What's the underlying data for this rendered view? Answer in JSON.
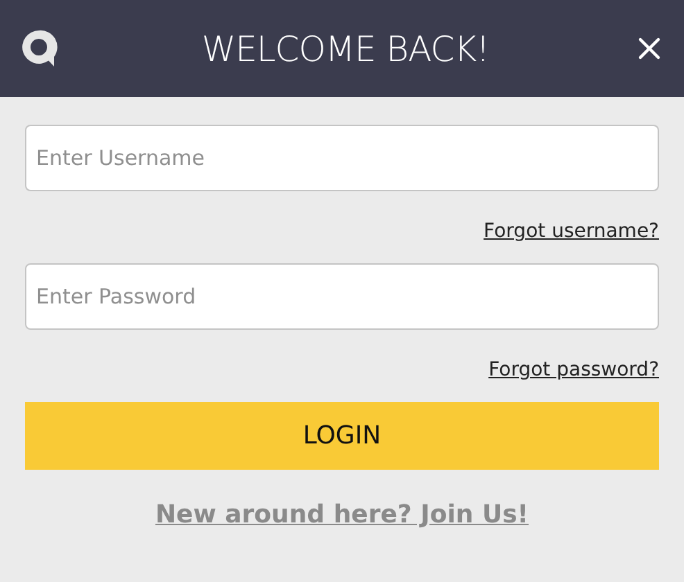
{
  "header": {
    "title": "WELCOME BACK!"
  },
  "fields": [
    {
      "placeholder": "Enter Username",
      "link": "Forgot username?"
    },
    {
      "placeholder": "Enter Password",
      "link": "Forgot password?"
    }
  ],
  "login_button": "LOGIN",
  "join_link": "New around here? Join Us!"
}
